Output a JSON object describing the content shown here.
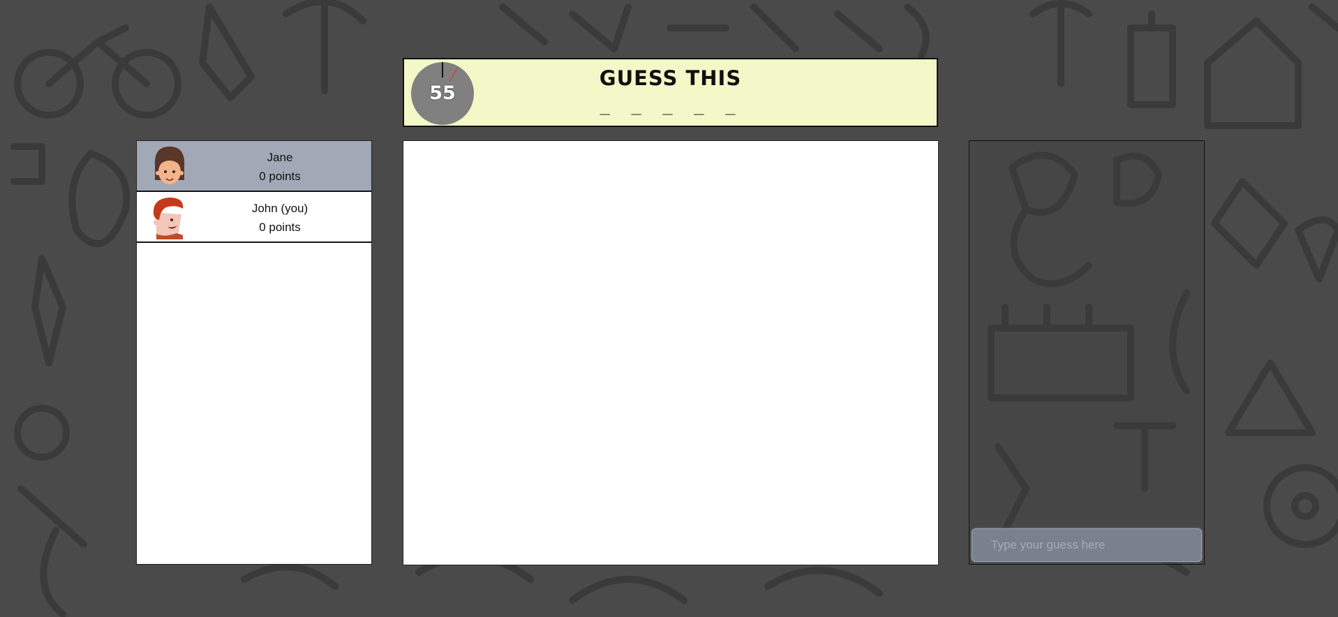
{
  "header": {
    "timer_value": "55",
    "timer_fraction": 0.083,
    "title": "GUESS THIS",
    "word_hint": "_ _ _ _ _"
  },
  "players": [
    {
      "name": "Jane",
      "points": "0 points",
      "active": true,
      "avatar_icon": "girl-avatar-icon"
    },
    {
      "name": "John (you)",
      "points": "0 points",
      "active": false,
      "avatar_icon": "boy-avatar-icon"
    }
  ],
  "chat": {
    "placeholder": "Type your guess here"
  },
  "colors": {
    "header_bg": "#f2f8c8",
    "active_player_bg": "#a2a9b6",
    "page_bg": "#4a4a4a",
    "timer_face": "#808080",
    "timer_hand": "#d04040"
  }
}
